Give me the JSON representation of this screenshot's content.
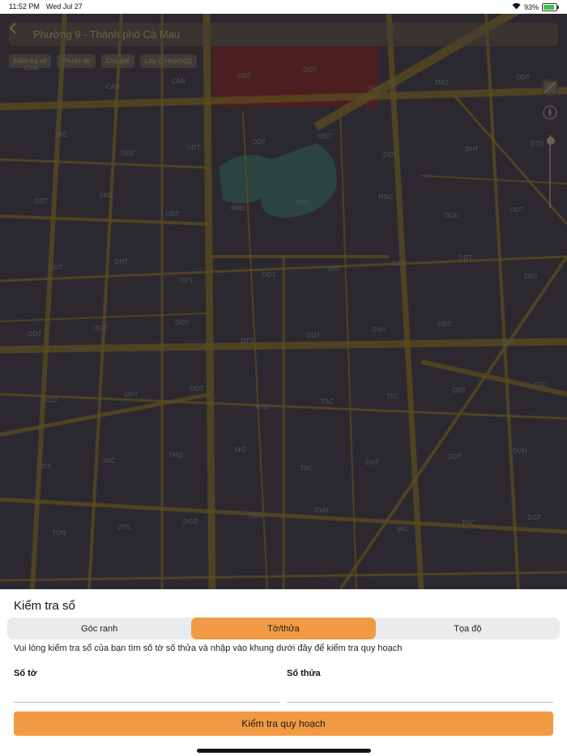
{
  "status_bar": {
    "time": "11:52 PM",
    "date": "Wed Jul 27",
    "battery": "93%"
  },
  "header": {
    "title": "Phường 9 - Thành phố Cà Mau"
  },
  "chips": [
    "Kiểm tra số",
    "Thước đo",
    "Chú giải",
    "Lớp Q.Hoạch(2)"
  ],
  "map_labels": [
    {
      "t": "CAN"
    },
    {
      "t": "CAN"
    },
    {
      "t": "CAN"
    },
    {
      "t": "ODT"
    },
    {
      "t": "ODT"
    },
    {
      "t": "DGD"
    },
    {
      "t": "TMD"
    },
    {
      "t": "ODT"
    },
    {
      "t": "SKC"
    },
    {
      "t": "ODT"
    },
    {
      "t": "ODT"
    },
    {
      "t": "ODT"
    },
    {
      "t": "ODT"
    },
    {
      "t": "ODT"
    },
    {
      "t": "DHT"
    },
    {
      "t": "DTS"
    },
    {
      "t": "ODT"
    },
    {
      "t": "SKC"
    },
    {
      "t": "ODT"
    },
    {
      "t": "MNC"
    },
    {
      "t": "DVH"
    },
    {
      "t": "MNC"
    },
    {
      "t": "DGD"
    },
    {
      "t": "ODT"
    },
    {
      "t": "ODT"
    },
    {
      "t": "DHT"
    },
    {
      "t": "DTS"
    },
    {
      "t": "ODT"
    },
    {
      "t": "DHT"
    },
    {
      "t": "ODT"
    },
    {
      "t": "ODT"
    },
    {
      "t": "ODT"
    },
    {
      "t": "ODT"
    },
    {
      "t": "DGD"
    },
    {
      "t": "ODT"
    },
    {
      "t": "DTS"
    },
    {
      "t": "ODT"
    },
    {
      "t": "DVH"
    },
    {
      "t": "ODT"
    },
    {
      "t": "DHT"
    },
    {
      "t": "DGD"
    },
    {
      "t": "ODT"
    },
    {
      "t": "ODT"
    },
    {
      "t": "NTD"
    },
    {
      "t": "TSC"
    },
    {
      "t": "TSC"
    },
    {
      "t": "ODT"
    },
    {
      "t": "TSC"
    },
    {
      "t": "ODT"
    },
    {
      "t": "SKC"
    },
    {
      "t": "TMD"
    },
    {
      "t": "SKC"
    },
    {
      "t": "TSC"
    },
    {
      "t": "DHT"
    },
    {
      "t": "ODT"
    },
    {
      "t": "DVH"
    },
    {
      "t": "TON"
    },
    {
      "t": "DTS"
    },
    {
      "t": "DGD"
    },
    {
      "t": "ODT"
    },
    {
      "t": "DVH"
    },
    {
      "t": "SKC"
    },
    {
      "t": "TSC"
    },
    {
      "t": "DGT"
    }
  ],
  "panel": {
    "title": "Kiểm tra sổ",
    "tabs": [
      {
        "label": "Góc ranh",
        "active": false
      },
      {
        "label": "Tờ/thửa",
        "active": true
      },
      {
        "label": "Tọa độ",
        "active": false
      }
    ],
    "instruction": "Vui lòng kiểm tra sổ của bạn tìm số tờ số thửa và nhập vào khung dưới đây để kiểm tra quy hoạch",
    "field_so_to": {
      "label": "Số tờ",
      "value": ""
    },
    "field_so_thua": {
      "label": "Số thửa",
      "value": ""
    },
    "submit_label": "Kiểm tra quy hoạch"
  },
  "colors": {
    "accent": "#f29a43",
    "map_bg": "#2e2a33",
    "road": "#6b5a1c",
    "red_zone": "#5a1d1d",
    "water": "#2c4e4a"
  }
}
